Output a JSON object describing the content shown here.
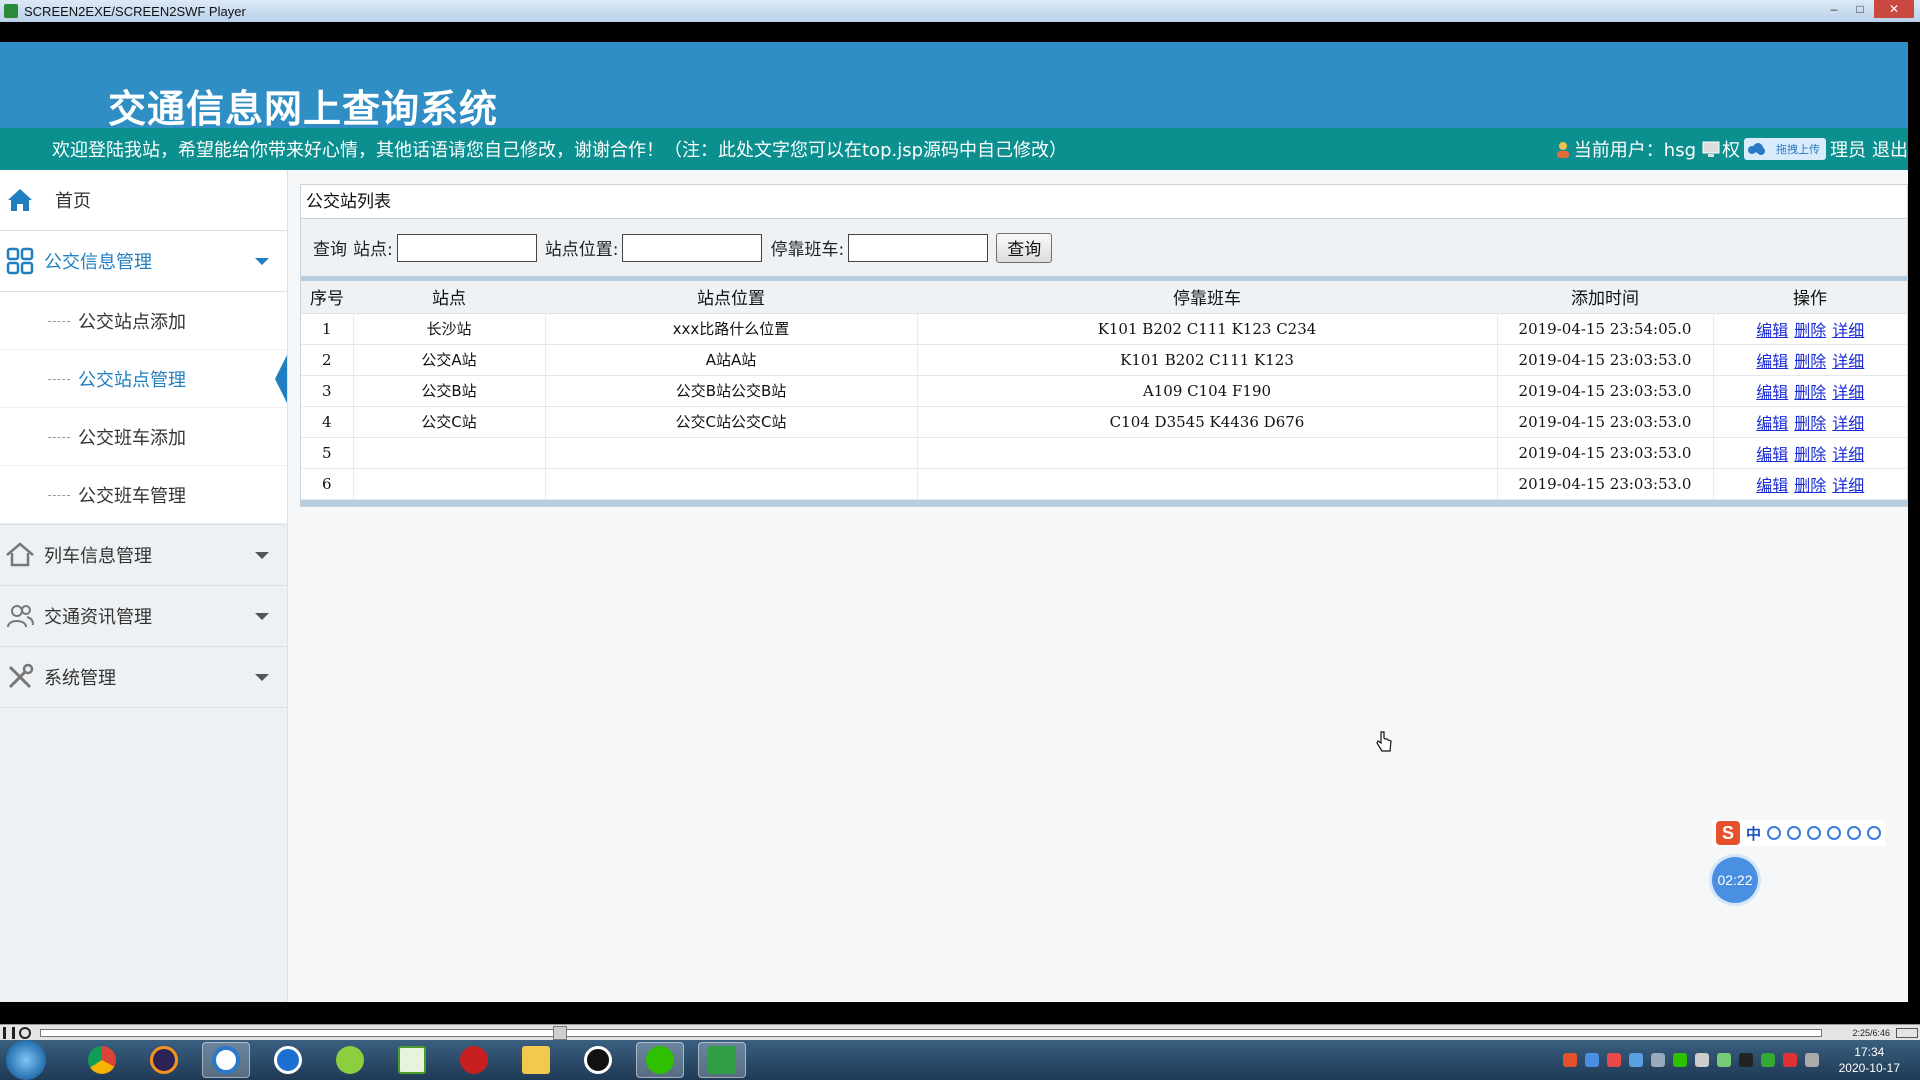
{
  "window": {
    "title": "SCREEN2EXE/SCREEN2SWF Player"
  },
  "app": {
    "title": "交通信息网上查询系统",
    "welcome": "欢迎登陆我站，希望能给你带来好心情，其他话语请您自己修改，谢谢合作！（注：此处文字您可以在top.jsp源码中自己修改）",
    "user_label": "当前用户：hsg",
    "role_text_before": "权",
    "upload_badge": "拖拽上传",
    "role_text_after": "理员",
    "logout_label": "退出"
  },
  "sidebar": {
    "home": "首页",
    "groups": [
      {
        "label": "公交信息管理",
        "open": true,
        "items": [
          "公交站点添加",
          "公交站点管理",
          "公交班车添加",
          "公交班车管理"
        ],
        "active_index": 1
      },
      {
        "label": "列车信息管理",
        "open": false
      },
      {
        "label": "交通资讯管理",
        "open": false
      },
      {
        "label": "系统管理",
        "open": false
      }
    ]
  },
  "panel": {
    "title": "公交站列表",
    "search": {
      "prefix": "查询",
      "station_label": "站点:",
      "location_label": "站点位置:",
      "bus_label": "停靠班车:",
      "station_value": "",
      "location_value": "",
      "bus_value": "",
      "submit": "查询"
    },
    "columns": [
      "序号",
      "站点",
      "站点位置",
      "停靠班车",
      "添加时间",
      "操作"
    ],
    "rows": [
      {
        "no": "1",
        "station": "长沙站",
        "location": "xxx比路什么位置",
        "buses": "K101 B202 C111 K123 C234",
        "time": "2019-04-15 23:54:05.0"
      },
      {
        "no": "2",
        "station": "公交A站",
        "location": "A站A站",
        "buses": "K101 B202 C111 K123",
        "time": "2019-04-15 23:03:53.0"
      },
      {
        "no": "3",
        "station": "公交B站",
        "location": "公交B站公交B站",
        "buses": "A109 C104 F190",
        "time": "2019-04-15 23:03:53.0"
      },
      {
        "no": "4",
        "station": "公交C站",
        "location": "公交C站公交C站",
        "buses": "C104 D3545 K4436 D676",
        "time": "2019-04-15 23:03:53.0"
      },
      {
        "no": "5",
        "station": "",
        "location": "",
        "buses": "",
        "time": "2019-04-15 23:03:53.0"
      },
      {
        "no": "6",
        "station": "",
        "location": "",
        "buses": "",
        "time": "2019-04-15 23:03:53.0"
      }
    ],
    "actions": [
      "编辑",
      "删除",
      "详细"
    ]
  },
  "overlay": {
    "ime_mode": "中",
    "timer": "02:22"
  },
  "player": {
    "time": "2:25/6:46",
    "progress": 0.29
  },
  "taskbar": {
    "clock_time": "17:34",
    "clock_date": "2020-10-17"
  },
  "colors": {
    "banner": "#2f8fc4",
    "welcome_bar": "#0b8f8f",
    "accent": "#1f7fc0",
    "link": "#1a2bd6"
  }
}
